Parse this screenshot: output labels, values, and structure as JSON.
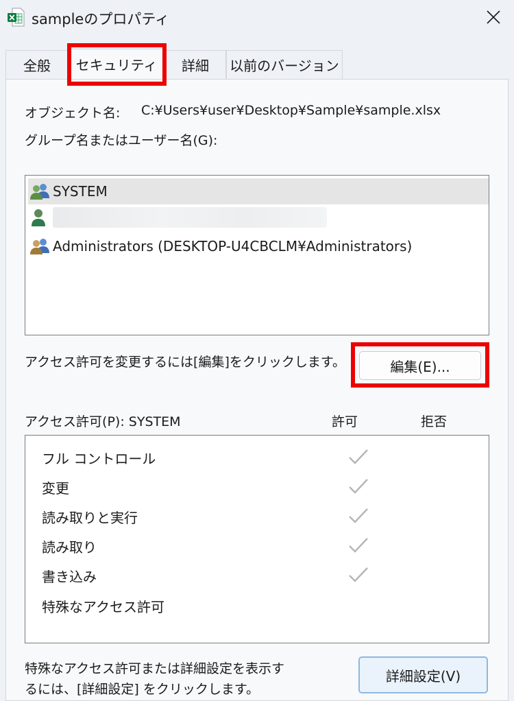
{
  "window": {
    "title": "sampleのプロパティ",
    "app_icon": "excel-file-icon",
    "close_icon": "close-icon"
  },
  "tabs": [
    {
      "label": "全般"
    },
    {
      "label": "セキュリティ",
      "active": true
    },
    {
      "label": "詳細"
    },
    {
      "label": "以前のバージョン"
    }
  ],
  "security": {
    "object_name_label": "オブジェクト名:",
    "object_name_value": "C:¥Users¥user¥Desktop¥Sample¥sample.xlsx",
    "group_label": "グループ名またはユーザー名(G):",
    "principals": [
      {
        "name": "SYSTEM",
        "icon": "user-group-icon",
        "selected": true
      },
      {
        "name": "",
        "icon": "user-icon",
        "redacted": true
      },
      {
        "name": "Administrators (DESKTOP-U4CBCLM¥Administrators)",
        "icon": "user-group-icon"
      }
    ],
    "edit_hint": "アクセス許可を変更するには[編集]をクリックします。",
    "edit_button": "編集(E)...",
    "perm_header": "アクセス許可(P): SYSTEM",
    "allow_header": "許可",
    "deny_header": "拒否",
    "permissions": [
      {
        "name": "フル コントロール",
        "allow": true,
        "deny": false
      },
      {
        "name": "変更",
        "allow": true,
        "deny": false
      },
      {
        "name": "読み取りと実行",
        "allow": true,
        "deny": false
      },
      {
        "name": "読み取り",
        "allow": true,
        "deny": false
      },
      {
        "name": "書き込み",
        "allow": true,
        "deny": false
      },
      {
        "name": "特殊なアクセス許可",
        "allow": false,
        "deny": false
      }
    ],
    "advanced_hint_line1": "特殊なアクセス許可または詳細設定を表示す",
    "advanced_hint_line2": "るには、[詳細設定] をクリックします。",
    "advanced_button": "詳細設定(V)"
  },
  "colors": {
    "highlight": "#ec0000",
    "check": "#b5b5b5",
    "selected_row": "#e5e5e5"
  }
}
